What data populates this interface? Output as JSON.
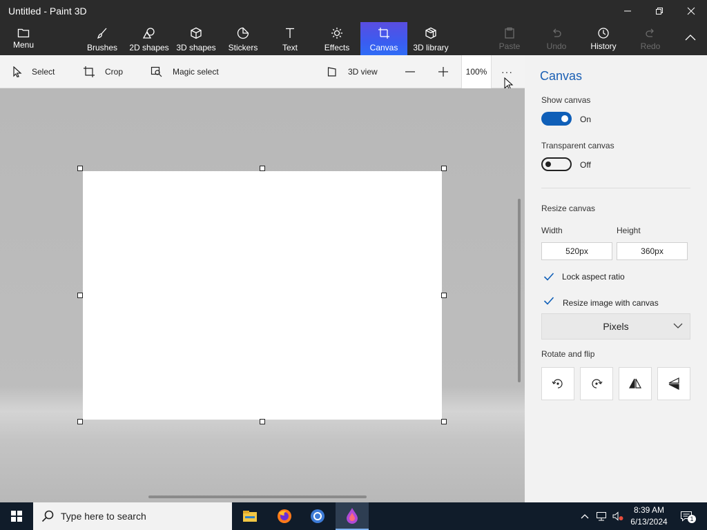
{
  "window": {
    "title": "Untitled - Paint 3D"
  },
  "ribbon": {
    "menu": "Menu",
    "tabs": [
      {
        "label": "Brushes",
        "icon": "brush-icon"
      },
      {
        "label": "2D shapes",
        "icon": "2d-shapes-icon"
      },
      {
        "label": "3D shapes",
        "icon": "3d-shapes-icon"
      },
      {
        "label": "Stickers",
        "icon": "stickers-icon"
      },
      {
        "label": "Text",
        "icon": "text-icon"
      },
      {
        "label": "Effects",
        "icon": "effects-icon"
      },
      {
        "label": "Canvas",
        "icon": "canvas-icon",
        "active": true
      },
      {
        "label": "3D library",
        "icon": "3d-library-icon"
      }
    ],
    "actions": {
      "paste": "Paste",
      "undo": "Undo",
      "history": "History",
      "redo": "Redo"
    },
    "accent": "#3b5cf0"
  },
  "toolbar": {
    "select": "Select",
    "crop": "Crop",
    "magic_select": "Magic select",
    "view_3d": "3D view",
    "zoom": "100%",
    "more": "···"
  },
  "panel": {
    "title": "Canvas",
    "show_canvas": {
      "label": "Show canvas",
      "state": "On"
    },
    "transparent_canvas": {
      "label": "Transparent canvas",
      "state": "Off"
    },
    "resize_canvas": "Resize canvas",
    "width_label": "Width",
    "height_label": "Height",
    "width_value": "520px",
    "height_value": "360px",
    "lock_aspect_ratio": "Lock aspect ratio",
    "resize_image_with_canvas": "Resize image with canvas",
    "unit": "Pixels",
    "rotate_and_flip": "Rotate and flip",
    "accent": "#0f5fb8"
  },
  "taskbar": {
    "search_placeholder": "Type here to search",
    "time": "8:39 AM",
    "date": "6/13/2024",
    "notification_count": "1"
  }
}
